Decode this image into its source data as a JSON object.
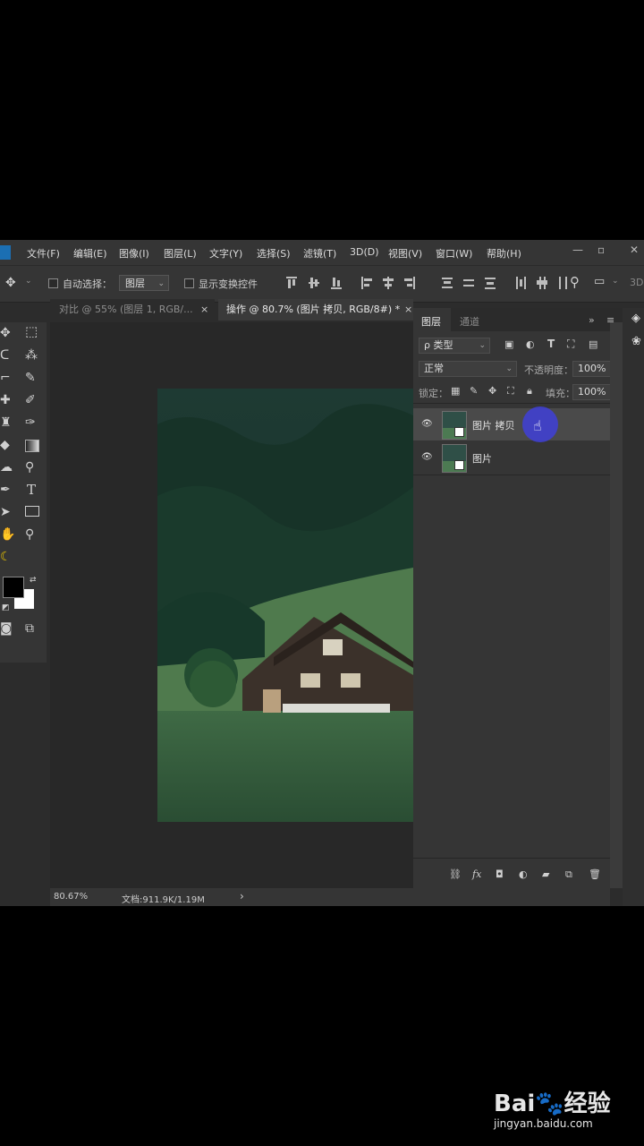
{
  "menu": {
    "items": [
      "文件(F)",
      "编辑(E)",
      "图像(I)",
      "图层(L)",
      "文字(Y)",
      "选择(S)",
      "滤镜(T)",
      "3D(D)",
      "视图(V)",
      "窗口(W)",
      "帮助(H)"
    ]
  },
  "options": {
    "auto_select_label": "自动选择：",
    "auto_select_value": "图层",
    "show_transform_label": "显示变换控件",
    "threed_label": "3D"
  },
  "tabs": [
    {
      "label": "对比 @ 55% (图层 1, RGB/...",
      "close": "×"
    },
    {
      "label": "操作 @ 80.7% (图片 拷贝, RGB/8#) *",
      "close": "×"
    }
  ],
  "layers_panel": {
    "tab_layers": "图层",
    "tab_channels": "通道",
    "menu_icon": "»",
    "filter_value": "ρ 类型",
    "blend_mode": "正常",
    "opacity_label": "不透明度：",
    "opacity_value": "100%",
    "lock_label": "锁定：",
    "fill_label": "填充：",
    "fill_value": "100%",
    "layers": [
      {
        "name": "图片 拷贝",
        "selected": true
      },
      {
        "name": "图片",
        "selected": false
      }
    ],
    "bottom_icons": [
      "link-icon",
      "fx-icon",
      "mask-icon",
      "adjustment-icon",
      "folder-icon",
      "new-layer-icon",
      "trash-icon"
    ],
    "fx_label": "fx"
  },
  "toolbar": {
    "type_tool": "T"
  },
  "status": {
    "zoom": "80.67%",
    "doc": "文档:911.9K/1.19M",
    "arrow": "›"
  },
  "watermark": {
    "brand": "Bai🐾经验",
    "url": "jingyan.baidu.com"
  },
  "colors": {
    "foreground": "#000000",
    "background": "#ffffff",
    "cursor_highlight": "#3f3fd8"
  }
}
